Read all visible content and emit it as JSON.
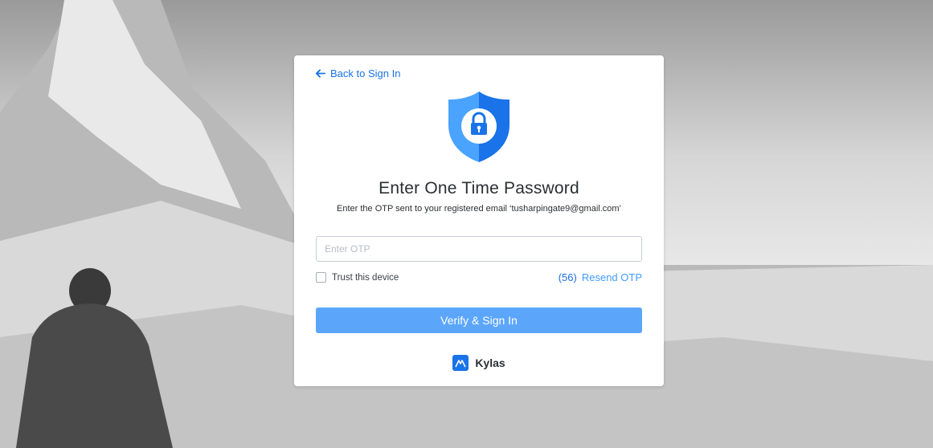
{
  "back_link": {
    "label": "Back to Sign In"
  },
  "heading": {
    "title": "Enter One Time Password",
    "subtitle": "Enter the OTP sent to your registered email ‘tusharpingate9@gmail.com’"
  },
  "otp_field": {
    "placeholder": "Enter OTP",
    "value": ""
  },
  "trust_device": {
    "label": "Trust this device",
    "checked": false
  },
  "resend": {
    "timer": "(56)",
    "label": "Resend OTP"
  },
  "verify_button": {
    "label": "Verify & Sign In"
  },
  "brand": {
    "name": "Kylas"
  },
  "colors": {
    "accent": "#1a73e8",
    "button": "#5ba6fb",
    "shield_light": "#4aa3ff",
    "shield_dark": "#1a73e8"
  },
  "icons": {
    "back": "arrow-left-icon",
    "shield": "shield-lock-icon",
    "logo": "kylas-logo-icon"
  }
}
